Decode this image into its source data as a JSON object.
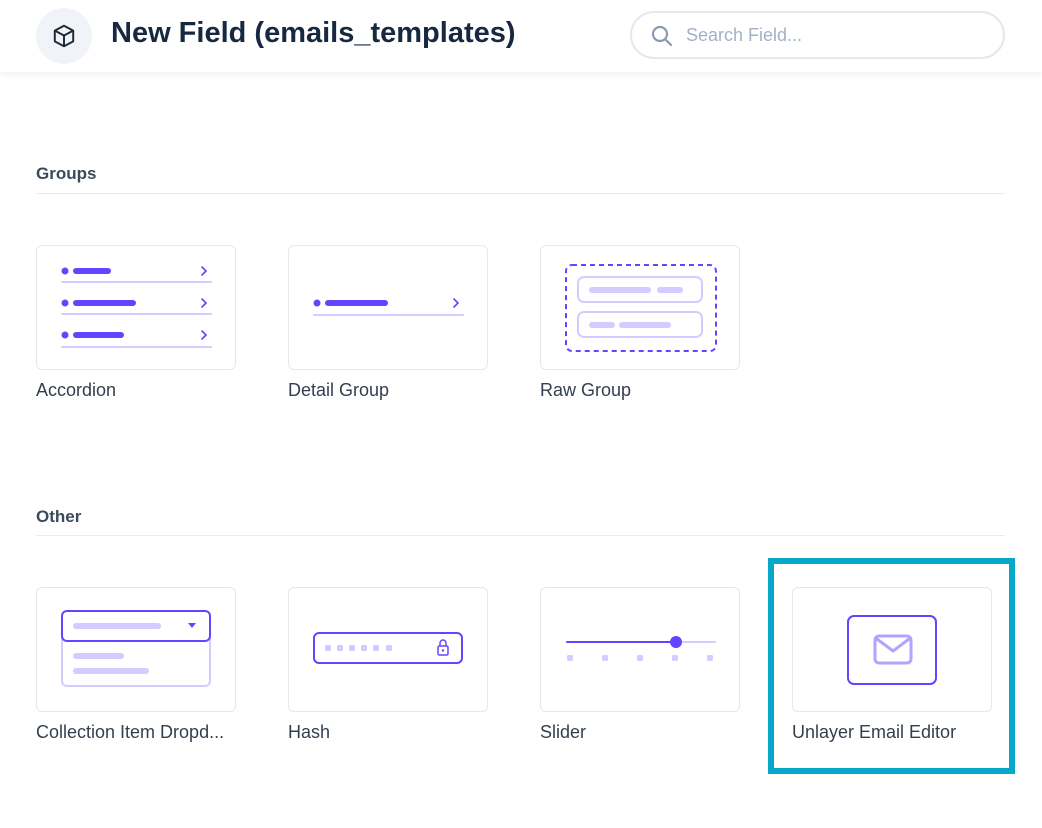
{
  "header": {
    "icon": "cube-icon",
    "title": "New Field (emails_templates)",
    "search_placeholder": "Search Field...",
    "search_value": ""
  },
  "sections": [
    {
      "title": "Groups",
      "items": [
        {
          "label": "Accordion",
          "icon": "accordion-icon"
        },
        {
          "label": "Detail Group",
          "icon": "detail-group-icon"
        },
        {
          "label": "Raw Group",
          "icon": "raw-group-icon"
        }
      ]
    },
    {
      "title": "Other",
      "items": [
        {
          "label": "Collection Item Dropd...",
          "icon": "dropdown-icon"
        },
        {
          "label": "Hash",
          "icon": "hash-icon"
        },
        {
          "label": "Slider",
          "icon": "slider-icon"
        },
        {
          "label": "Unlayer Email Editor",
          "icon": "email-icon",
          "highlighted": true
        }
      ]
    }
  ],
  "colors": {
    "accent": "#6644ff",
    "accent_light": "#d4ccff",
    "highlight": "#05a8c8",
    "title": "#172940"
  }
}
